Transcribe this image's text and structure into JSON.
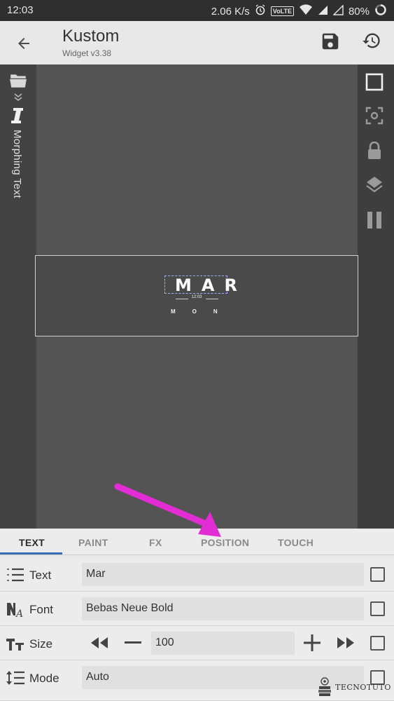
{
  "status_bar": {
    "time": "12:03",
    "network_speed": "2.06 K/s",
    "volte": "VoLTE",
    "battery": "80%"
  },
  "app_bar": {
    "title": "Kustom",
    "subtitle": "Widget v3.38"
  },
  "left_rail": {
    "vertical_label": "Morphing Text"
  },
  "preview": {
    "big_text": "MAR",
    "small_time": "12:03",
    "day_text": "MON"
  },
  "tabs": [
    {
      "label": "TEXT",
      "active": true
    },
    {
      "label": "PAINT",
      "active": false
    },
    {
      "label": "FX",
      "active": false
    },
    {
      "label": "POSITION",
      "active": false
    },
    {
      "label": "TOUCH",
      "active": false
    }
  ],
  "rows": {
    "text": {
      "label": "Text",
      "value": "Mar"
    },
    "font": {
      "label": "Font",
      "value": "Bebas Neue Bold"
    },
    "size": {
      "label": "Size",
      "value": "100"
    },
    "mode": {
      "label": "Mode",
      "value": "Auto"
    }
  },
  "watermark": {
    "text": "TECNOTUTO"
  },
  "colors": {
    "accent": "#3b6db3",
    "arrow": "#e22cd4",
    "editor_bg": "#545454"
  },
  "icons": {
    "back": "arrow-left-icon",
    "save": "save-disk-icon",
    "history": "history-icon",
    "folder": "folder-icon",
    "expand": "chevron-double-down-icon",
    "text_cursor": "text-cursor-icon",
    "square": "square-outline-icon",
    "focus": "center-focus-icon",
    "lock": "lock-icon",
    "layers": "layers-icon",
    "pause": "pause-icon"
  }
}
